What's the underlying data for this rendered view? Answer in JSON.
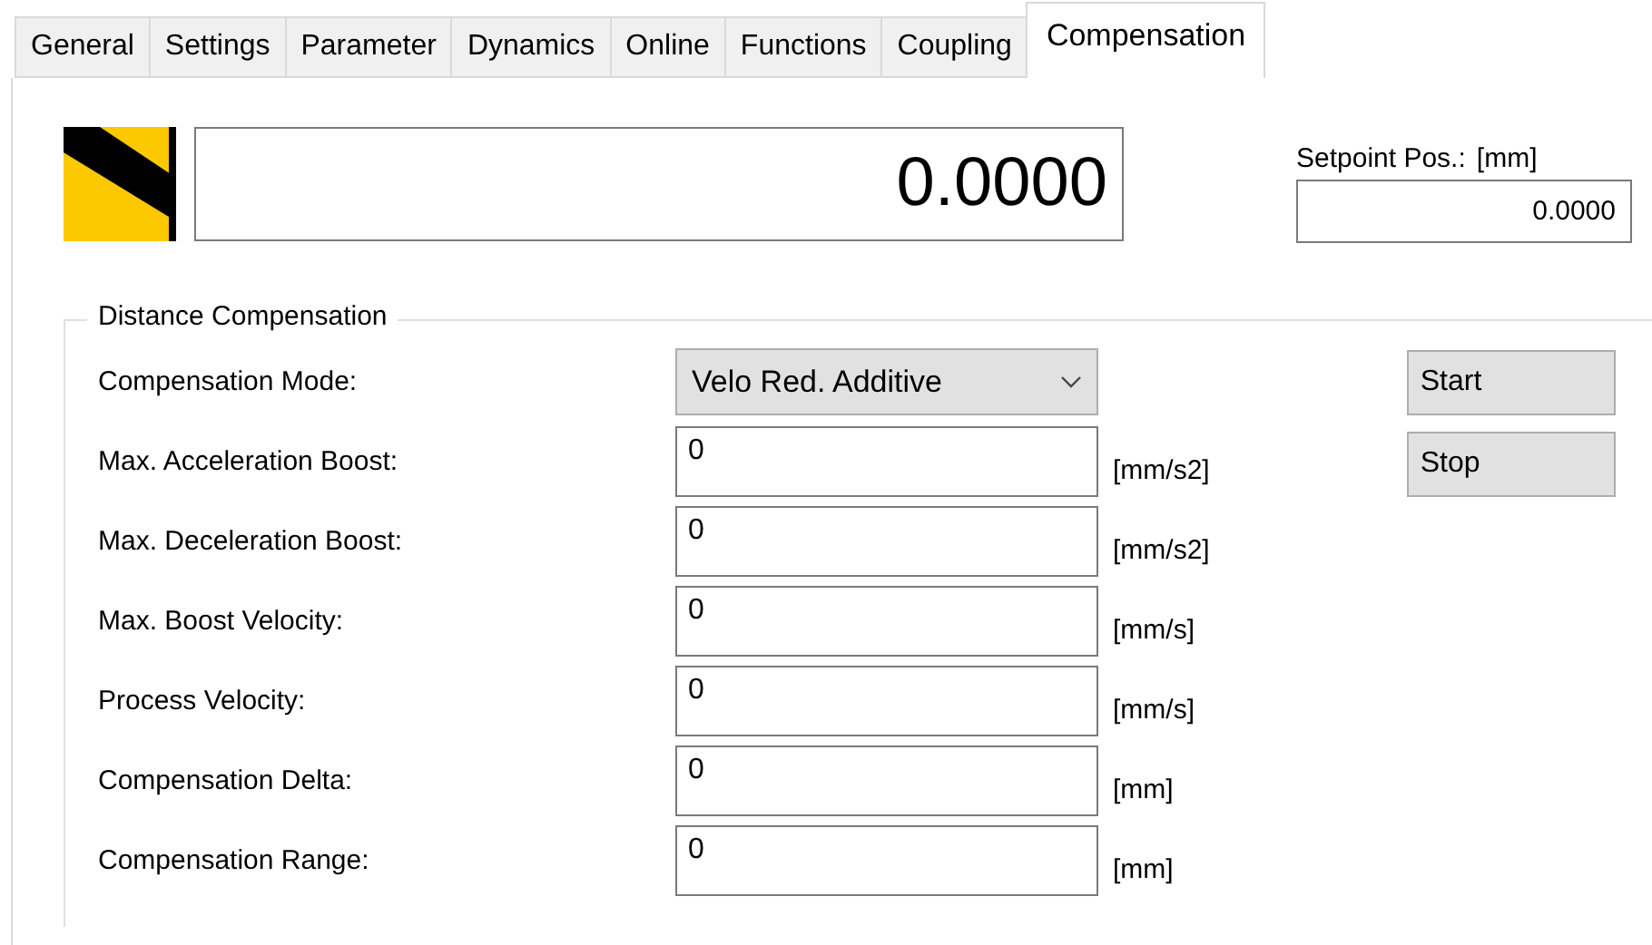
{
  "tabs": [
    {
      "label": "General",
      "selected": false
    },
    {
      "label": "Settings",
      "selected": false
    },
    {
      "label": "Parameter",
      "selected": false
    },
    {
      "label": "Dynamics",
      "selected": false
    },
    {
      "label": "Online",
      "selected": false
    },
    {
      "label": "Functions",
      "selected": false
    },
    {
      "label": "Coupling",
      "selected": false
    },
    {
      "label": "Compensation",
      "selected": true
    }
  ],
  "position_display": {
    "value": "0.0000"
  },
  "setpoint": {
    "label": "Setpoint Pos.:",
    "unit": "[mm]",
    "value": "0.0000"
  },
  "group": {
    "title": "Distance Compensation",
    "rows": [
      {
        "kind": "dropdown",
        "label": "Compensation Mode:",
        "value": "Velo Red. Additive"
      },
      {
        "kind": "field",
        "label": "Max. Acceleration Boost:",
        "value": "0",
        "unit": "[mm/s2]"
      },
      {
        "kind": "field",
        "label": "Max. Deceleration Boost:",
        "value": "0",
        "unit": "[mm/s2]"
      },
      {
        "kind": "field",
        "label": "Max. Boost Velocity:",
        "value": "0",
        "unit": "[mm/s]"
      },
      {
        "kind": "field",
        "label": "Process Velocity:",
        "value": "0",
        "unit": "[mm/s]"
      },
      {
        "kind": "field",
        "label": "Compensation Delta:",
        "value": "0",
        "unit": "[mm]"
      },
      {
        "kind": "field",
        "label": "Compensation Range:",
        "value": "0",
        "unit": "[mm]"
      }
    ],
    "buttons": [
      "Start",
      "Stop"
    ]
  }
}
